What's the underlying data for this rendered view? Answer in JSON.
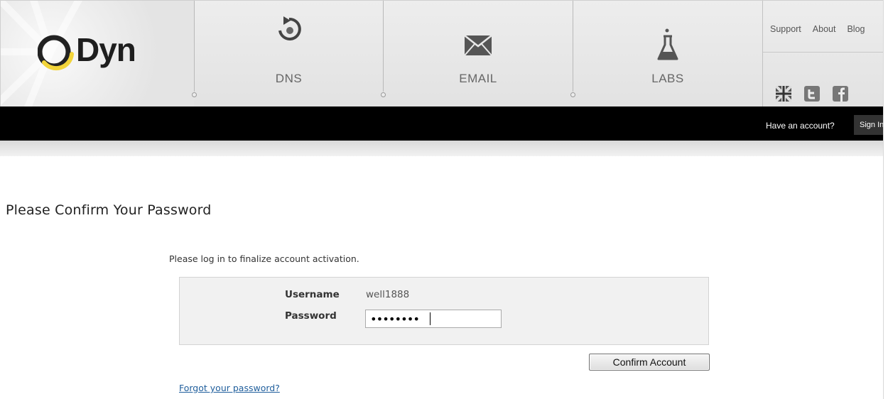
{
  "header": {
    "logo_text": "Dyn",
    "nav": [
      {
        "label": "DNS",
        "icon": "refresh-icon"
      },
      {
        "label": "EMAIL",
        "icon": "envelope-icon"
      },
      {
        "label": "LABS",
        "icon": "flask-icon"
      }
    ],
    "top_links": [
      "Support",
      "About",
      "Blog"
    ],
    "social_icons": [
      "uk-flag-icon",
      "twitter-icon",
      "facebook-icon"
    ]
  },
  "account_bar": {
    "have_account": "Have an account?",
    "sign_in_label": "Sign In"
  },
  "main": {
    "title": "Please Confirm Your Password",
    "intro": "Please log in to finalize account activation.",
    "form": {
      "username_label": "Username",
      "username_value": "well1888",
      "password_label": "Password",
      "password_value": "••••••••"
    },
    "confirm_button": "Confirm Account",
    "forgot_link": "Forgot your password?"
  },
  "colors": {
    "link": "#1f5e9c",
    "bar": "#000000",
    "logo_accent": "#f2d43a"
  }
}
